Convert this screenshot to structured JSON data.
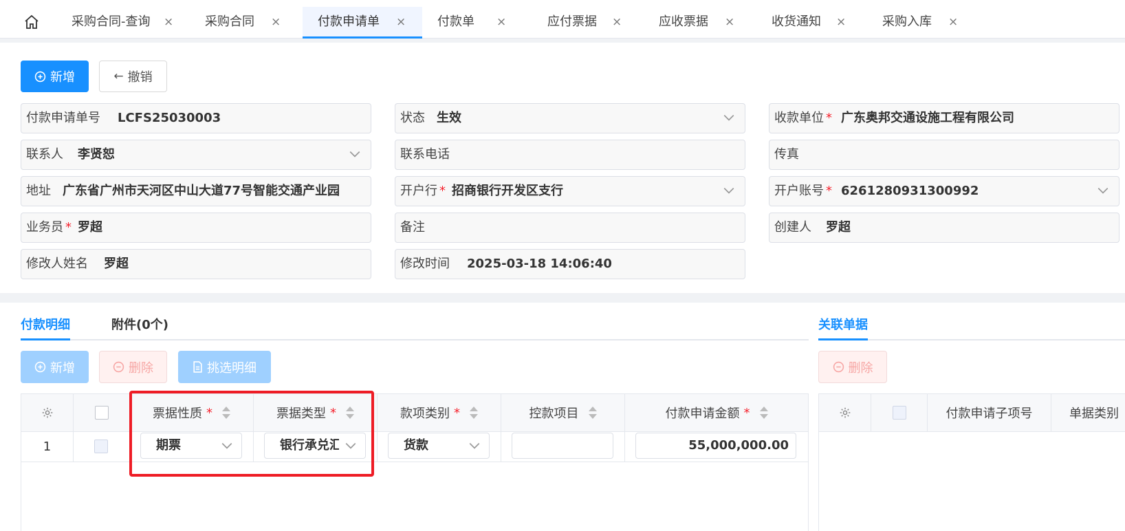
{
  "tabs": [
    {
      "label": "采购合同-查询",
      "close": "×"
    },
    {
      "label": "采购合同",
      "close": "×"
    },
    {
      "label": "付款申请单",
      "close": "×"
    },
    {
      "label": "付款单",
      "close": "×"
    },
    {
      "label": "应付票据",
      "close": "×"
    },
    {
      "label": "应收票据",
      "close": "×"
    },
    {
      "label": "收货通知",
      "close": "×"
    },
    {
      "label": "采购入库",
      "close": "×"
    }
  ],
  "toolbar": {
    "add": "新增",
    "undo": "撤销"
  },
  "form": {
    "req_no_label": "付款申请单号",
    "req_no": "LCFS25030003",
    "status_label": "状态",
    "status": "生效",
    "payee_label": "收款单位",
    "payee": "广东奥邦交通设施工程有限公司",
    "contact_label": "联系人",
    "contact": "李贤恕",
    "phone_label": "联系电话",
    "fax_label": "传真",
    "address_label": "地址",
    "address": "广东省广州市天河区中山大道77号智能交通产业园",
    "bank_label": "开户行",
    "bank": "招商银行开发区支行",
    "account_label": "开户账号",
    "account": "6261280931300992",
    "salesman_label": "业务员",
    "salesman": "罗超",
    "remark_label": "备注",
    "creator_label": "创建人",
    "creator": "罗超",
    "modifier_label": "修改人姓名",
    "modifier": "罗超",
    "modtime_label": "修改时间",
    "modtime": "2025-03-18 14:06:40",
    "required_mark": "*"
  },
  "detail": {
    "tab_detail": "付款明细",
    "tab_attach": "附件(0个)",
    "tab_related": "关联单据",
    "btn_add": "新增",
    "btn_delete": "删除",
    "btn_pick": "挑选明细",
    "btn_related_delete": "删除",
    "columns": {
      "bill_nature": "票据性质",
      "bill_type": "票据类型",
      "payment_category": "款项类别",
      "control_item": "控款项目",
      "amount": "付款申请金额"
    },
    "row": {
      "index": "1",
      "bill_nature": "期票",
      "bill_type": "银行承兑汇票",
      "payment_category": "货款",
      "control_item": "",
      "amount": "55,000,000.00"
    },
    "related_columns": {
      "sub_item": "付款申请子项号",
      "doc_type": "单据类别"
    }
  },
  "icons": {
    "home": "home-icon",
    "gear": "gear-icon",
    "chevron": "chevron-down-icon"
  },
  "colors": {
    "accent": "#1890ff",
    "danger": "#f5222d",
    "highlight": "#ee1c25"
  }
}
